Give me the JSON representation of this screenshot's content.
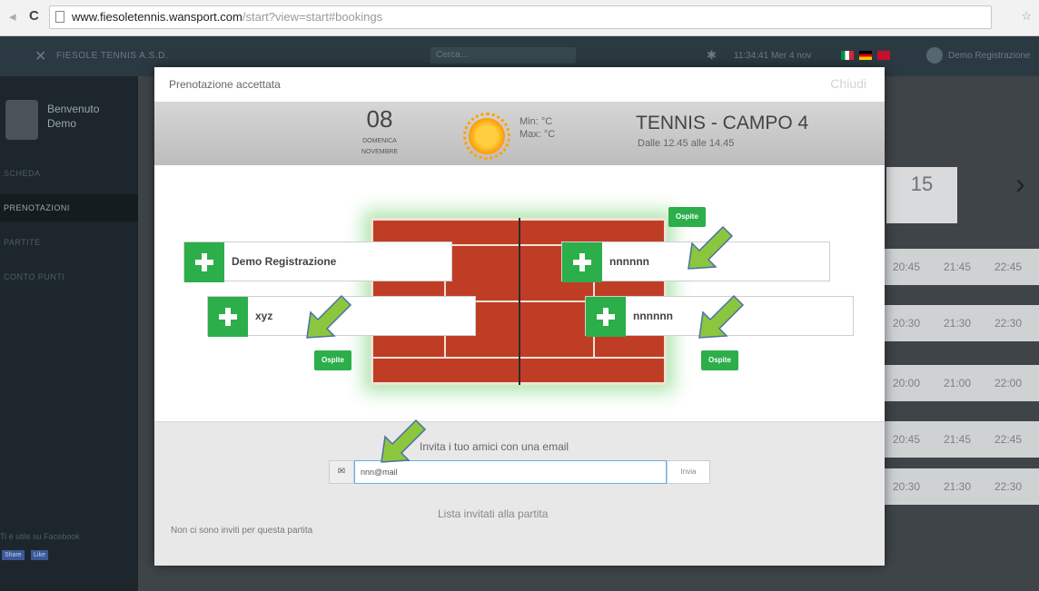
{
  "browser": {
    "url_host": "www.fiesoletennis.wansport.com",
    "url_path": "/start?view=start#bookings"
  },
  "appbar": {
    "club_name": "FIESOLE TENNIS A.S.D.",
    "search_placeholder": "Cerca...",
    "datetime": "11:34:41 Mer 4 nov",
    "user_name": "Demo Registrazione"
  },
  "sidebar": {
    "welcome_line1": "Benvenuto",
    "welcome_line2": "Demo",
    "items": [
      {
        "label": "SCHEDA"
      },
      {
        "label": "PRENOTAZIONI"
      },
      {
        "label": "PARTITE"
      },
      {
        "label": "CONTO PUNTI"
      }
    ],
    "facebook_text": "Ti è utile su Facebook",
    "fb_btn1": "Share",
    "fb_btn2": "Like"
  },
  "background": {
    "day_number": "15",
    "times": [
      [
        "20:45",
        "21:45",
        "22:45"
      ],
      [
        "20:30",
        "21:30",
        "22:30"
      ],
      [
        "20:00",
        "21:00",
        "22:00"
      ],
      [
        "20:45",
        "21:45",
        "22:45"
      ],
      [
        "20:30",
        "21:30",
        "22:30"
      ]
    ]
  },
  "modal": {
    "title": "Prenotazione accettata",
    "close_label": "Chiudi",
    "date_number": "08",
    "weekday": "DOMENICA",
    "month": "NOVEMBRE",
    "temp_min": "Min: °C",
    "temp_max": "Max: °C",
    "court_name": "TENNIS - CAMPO 4",
    "time_range": "Dalle 12.45 alle 14.45",
    "players": {
      "left_top": "Demo Registrazione",
      "left_bottom": "xyz",
      "right_top": "nnnnnn",
      "right_bottom": "nnnnnn"
    },
    "ospite_label": "Ospite",
    "invite_label": "Invita i tuo amici con una email",
    "email_value": "nnn@mail",
    "invia_label": "Invia",
    "invited_title": "Lista invitati alla partita",
    "no_invites": "Non ci sono inviti per questa partita"
  },
  "colors": {
    "accent_green": "#2cae4a",
    "court_red": "#c03d25",
    "annotation_arrow": "#8cc63f"
  }
}
